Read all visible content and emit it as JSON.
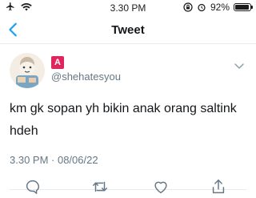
{
  "status_bar": {
    "time": "3.30 PM",
    "battery": "92%",
    "battery_level": 0.92,
    "icons": [
      "airplane-icon",
      "wifi-icon",
      "rotation-lock-icon",
      "alarm-icon",
      "battery-icon"
    ]
  },
  "nav": {
    "title": "Tweet",
    "back_icon": "chevron-left-icon",
    "accent": "#1da1f2"
  },
  "tweet": {
    "name_badge": "A",
    "handle": "@shehatesyou",
    "text": "km gk sopan yh bikin anak orang saltink hdeh",
    "timestamp": "3.30 PM · 08/06/22",
    "actions": [
      "reply-icon",
      "retweet-icon",
      "like-icon",
      "share-icon"
    ]
  },
  "colors": {
    "text": "#14171a",
    "secondary": "#657786",
    "badge": "#e0245e",
    "accent": "#1da1f2"
  }
}
